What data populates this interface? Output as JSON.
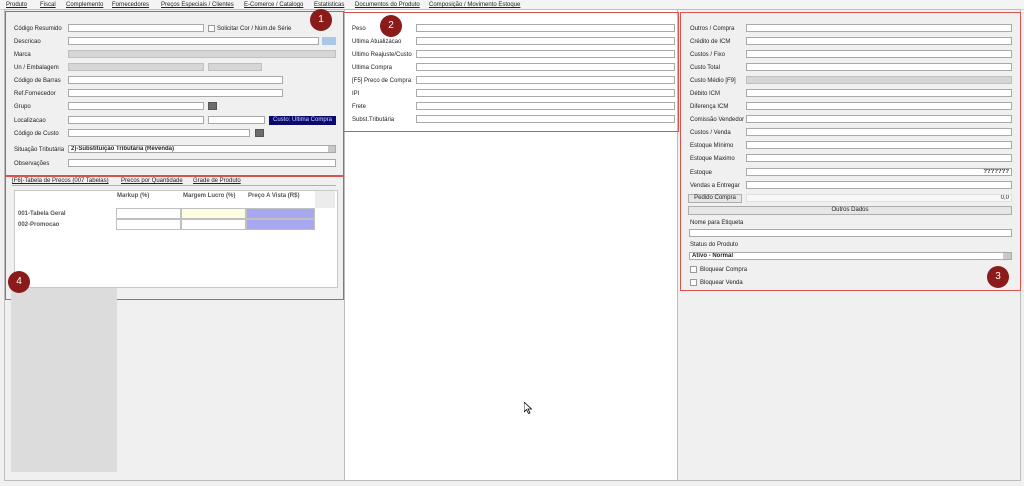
{
  "menu": [
    "Produto",
    "Fiscal",
    "Complemento",
    "Fornecedores",
    "Preços Especiais / Clientes",
    "E-Comerce / Catalogo",
    "Estatisticas",
    "Documentos do Produto",
    "Composição / Movimento Estoque"
  ],
  "panel1": {
    "badge": "1",
    "codigo_resumido": "Código Resumido",
    "solicitar_cor": "Solicitar Cor / Núm.de Série",
    "descricao": "Descricao",
    "marca": "Marca",
    "un_embalagem": "Un / Embalagem",
    "codigo_barras": "Código de Barras",
    "ref_fornecedor": "Ref.Fornecedor",
    "grupo": "Grupo",
    "localizacao": "Localizacao",
    "custo_button": "Custo: Ultima Compra",
    "codigo_custo": "Código de Custo",
    "situacao_tributaria": "Situação Tributária",
    "situacao_value": "2)-Substituição Tributária (Revenda)",
    "observacoes": "Observações"
  },
  "panel2": {
    "badge": "2",
    "fields": [
      "Peso",
      "Ultima Atualizacao",
      "Ultimo Reajuste/Custo",
      "Ultima Compra",
      "[F5] Preco de Compra",
      "IPI",
      "Frete",
      "Subst.Tributária"
    ]
  },
  "panel3": {
    "badge": "3",
    "fields": [
      "Outros / Compra",
      "Crédito de ICM",
      "Custos / Fixo",
      "Custo Total",
      "Custo Médio [F9]",
      "Débito ICM",
      "Diferença ICM",
      "Comissão Vendedor",
      "Custos / Venda",
      "Estoque Mínimo",
      "Estoque Maximo",
      "Estoque",
      "Vendas a Entregar"
    ],
    "estoque_value": "???????",
    "pedido_compra": "Pedido Compra",
    "pedido_value": "0,0",
    "outros_dados": "Outros Dados",
    "nome_etiqueta": "Nome para Etiqueta",
    "status_produto": "Status do Produto",
    "status_value": "Ativo - Normal",
    "bloquear_compra": "Bloquear Compra",
    "bloquear_venda": "Bloquear Venda"
  },
  "panel4": {
    "badge": "4",
    "tabs": [
      "[F6]-Tabela de Precos  (007 Tabelas)",
      "Precos por Quantidade",
      "Grade de Produto"
    ],
    "columns": [
      "Markup (%)",
      "Margem Lucro (%)",
      "Preço A Vista (R$)"
    ],
    "rows": [
      "001-Tabela Geral",
      "002-Promocao"
    ]
  }
}
